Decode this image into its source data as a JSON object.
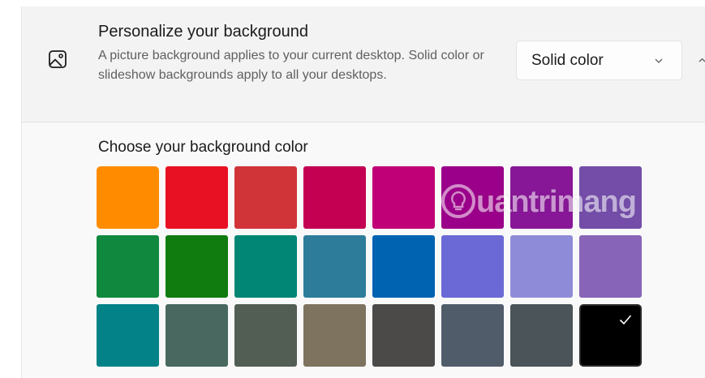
{
  "header": {
    "title": "Personalize your background",
    "description": "A picture background applies to your current desktop. Solid color or slideshow backgrounds apply to all your desktops.",
    "dropdown": {
      "selected": "Solid color"
    },
    "icon": "image-icon"
  },
  "colors": {
    "title": "Choose your background color",
    "swatches": [
      "#ff8c00",
      "#e81123",
      "#d13438",
      "#c30052",
      "#bf0077",
      "#9a0089",
      "#881798",
      "#744da9",
      "#10893e",
      "#107c10",
      "#018574",
      "#2d7d9a",
      "#0063b1",
      "#6b69d6",
      "#8e8cd8",
      "#8764b8",
      "#038387",
      "#486860",
      "#525e54",
      "#7e735f",
      "#4c4a48",
      "#515c6b",
      "#4a5459",
      "#000000"
    ],
    "selected_index": 23
  },
  "watermark": {
    "text": "uantrimang"
  }
}
